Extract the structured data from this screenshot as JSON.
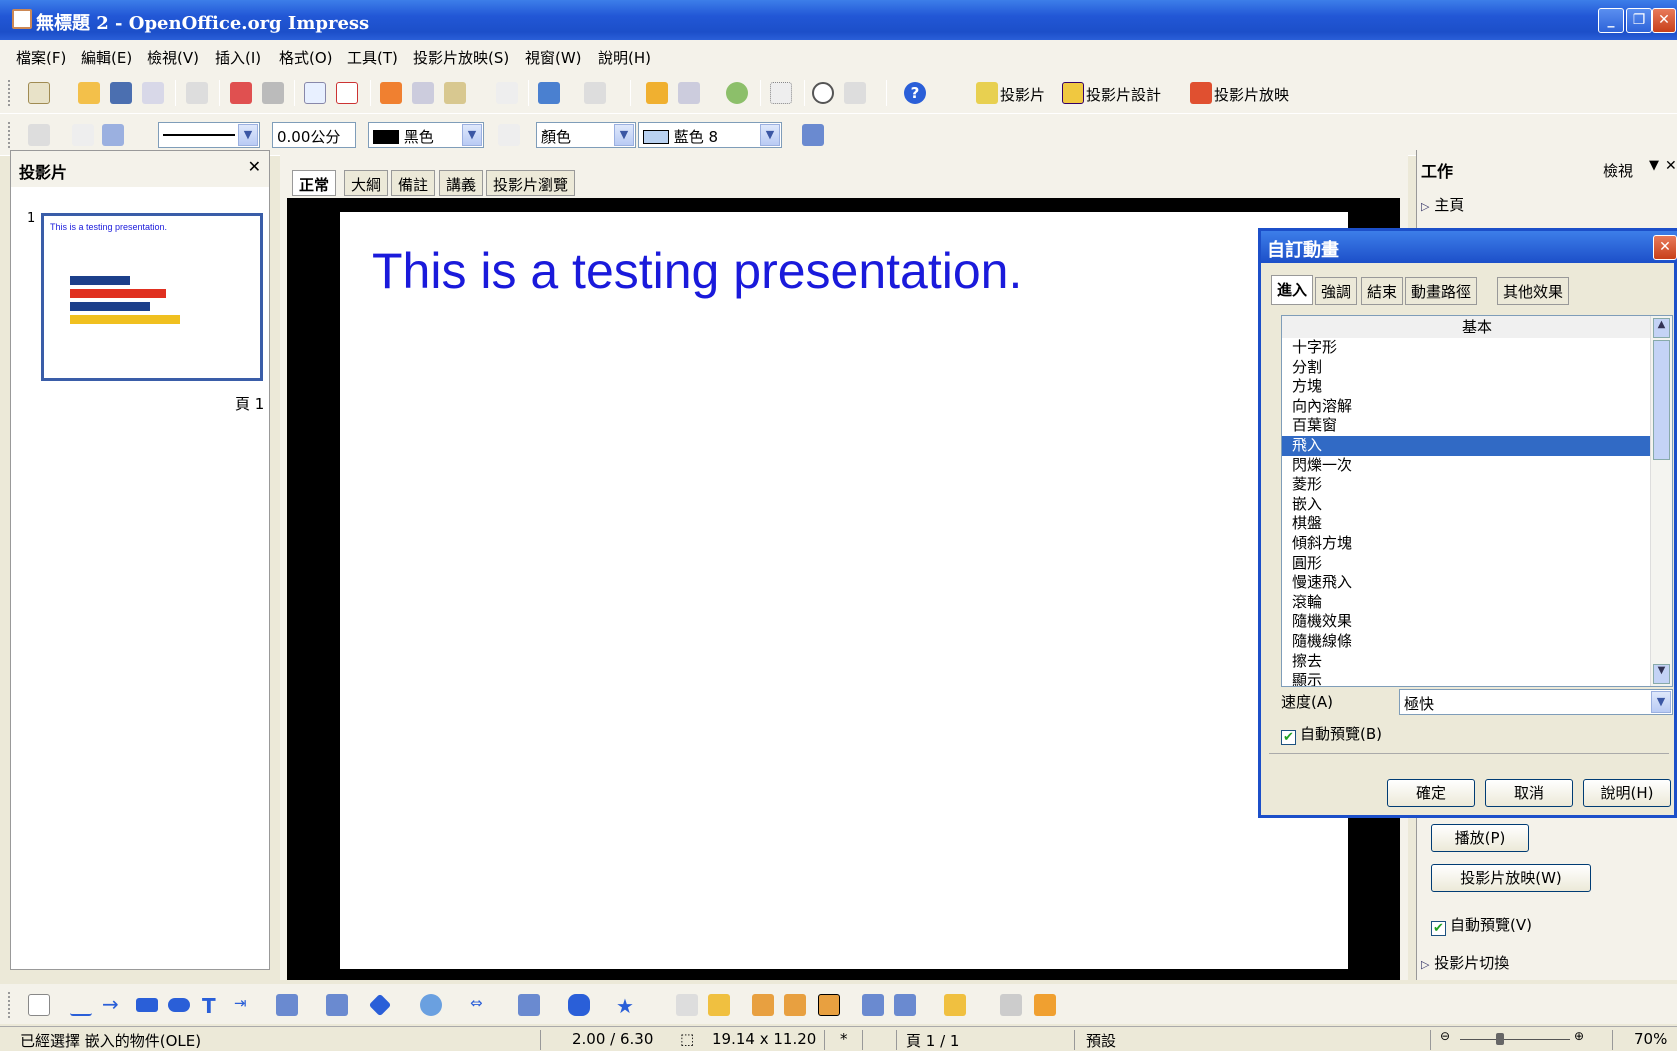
{
  "window": {
    "title": "無標題 2 - OpenOffice.org Impress"
  },
  "menu": [
    "檔案(F)",
    "編輯(E)",
    "檢視(V)",
    "插入(I)",
    "格式(O)",
    "工具(T)",
    "投影片放映(S)",
    "視窗(W)",
    "說明(H)"
  ],
  "toolbar1": {
    "slide_label": "投影片",
    "slide_design_label": "投影片設計",
    "slide_show_label": "投影片放映"
  },
  "toolbar2": {
    "line_width": "0.00公分",
    "line_color": "黑色",
    "area_style": "顏色",
    "area_color": "藍色 8"
  },
  "slides_pane": {
    "title": "投影片",
    "thumb_number": "1",
    "thumb_text": "This is a testing presentation.",
    "page_label": "頁 1"
  },
  "view_tabs": [
    "正常",
    "大綱",
    "備註",
    "講義",
    "投影片瀏覽"
  ],
  "slide": {
    "title": "This is a testing presentation."
  },
  "task_pane": {
    "title": "工作",
    "view_label": "檢視",
    "master_pages": "主頁",
    "play_button": "播放(P)",
    "slideshow_button": "投影片放映(W)",
    "auto_preview": "自動預覽(V)",
    "slide_transition": "投影片切換"
  },
  "dialog": {
    "title": "自訂動畫",
    "tabs": [
      "進入",
      "強調",
      "結束",
      "動畫路徑",
      "其他效果"
    ],
    "category": "基本",
    "effects": [
      "十字形",
      "分割",
      "方塊",
      "向內溶解",
      "百葉窗",
      "飛入",
      "閃爍一次",
      "菱形",
      "嵌入",
      "棋盤",
      "傾斜方塊",
      "圓形",
      "慢速飛入",
      "滾輪",
      "隨機效果",
      "隨機線條",
      "擦去",
      "顯示"
    ],
    "selected_effect": "飛入",
    "speed_label": "速度(A)",
    "speed_value": "極快",
    "auto_preview": "自動預覽(B)",
    "ok": "確定",
    "cancel": "取消",
    "help": "說明(H)"
  },
  "status": {
    "selection": "已經選擇 嵌入的物件(OLE)",
    "position": "2.00 / 6.30",
    "size": "19.14 x 11.20",
    "modified": "*",
    "page": "頁 1 / 1",
    "layout": "預設",
    "zoom": "70%"
  }
}
